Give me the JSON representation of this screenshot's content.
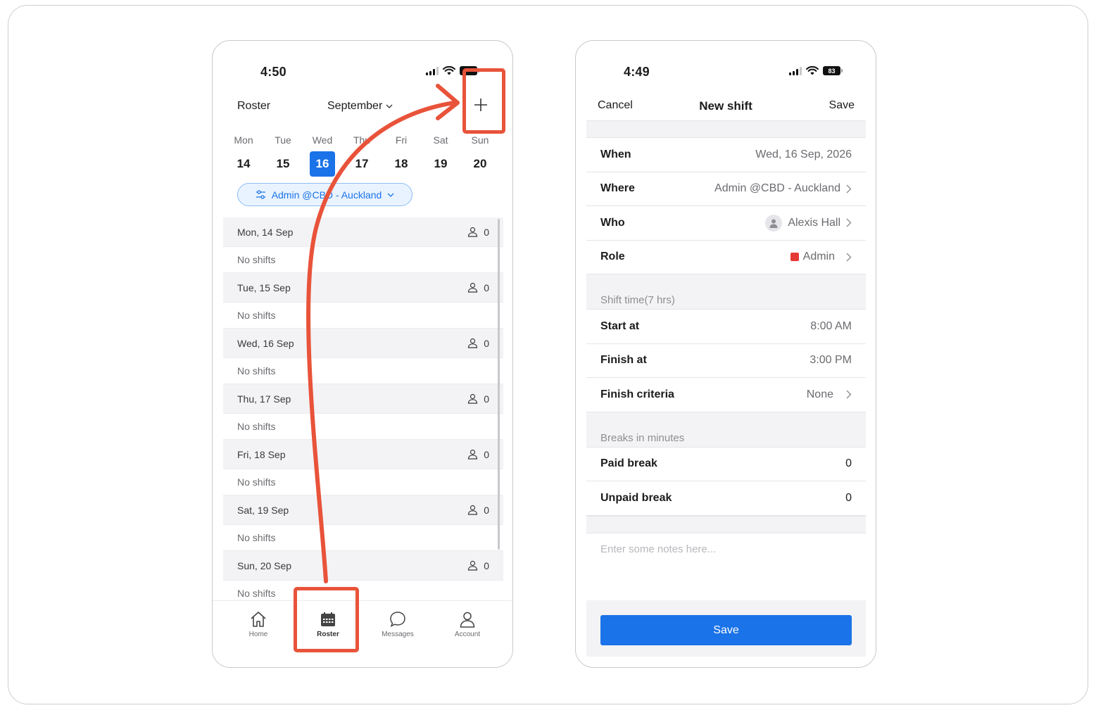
{
  "left_phone": {
    "status": {
      "time": "4:50"
    },
    "header": {
      "title": "Roster",
      "month": "September"
    },
    "week": [
      {
        "name": "Mon",
        "num": "14"
      },
      {
        "name": "Tue",
        "num": "15"
      },
      {
        "name": "Wed",
        "num": "16"
      },
      {
        "name": "Thu",
        "num": "17"
      },
      {
        "name": "Fri",
        "num": "18"
      },
      {
        "name": "Sat",
        "num": "19"
      },
      {
        "name": "Sun",
        "num": "20"
      }
    ],
    "selected_day": "16",
    "location_chip": "Admin @CBD - Auckland",
    "days": [
      {
        "label": "Mon, 14 Sep",
        "count": "0",
        "empty": "No shifts"
      },
      {
        "label": "Tue, 15 Sep",
        "count": "0",
        "empty": "No shifts"
      },
      {
        "label": "Wed, 16 Sep",
        "count": "0",
        "empty": "No shifts"
      },
      {
        "label": "Thu, 17 Sep",
        "count": "0",
        "empty": "No shifts"
      },
      {
        "label": "Fri, 18 Sep",
        "count": "0",
        "empty": "No shifts"
      },
      {
        "label": "Sat, 19 Sep",
        "count": "0",
        "empty": "No shifts"
      },
      {
        "label": "Sun, 20 Sep",
        "count": "0",
        "empty": "No shifts"
      }
    ],
    "tabs": [
      {
        "label": "Home",
        "icon": "home-icon"
      },
      {
        "label": "Roster",
        "icon": "calendar-icon"
      },
      {
        "label": "Messages",
        "icon": "chat-bubble-icon"
      },
      {
        "label": "Account",
        "icon": "person-icon"
      }
    ],
    "active_tab": "Roster"
  },
  "right_phone": {
    "status": {
      "time": "4:49",
      "battery": "83"
    },
    "nav": {
      "cancel": "Cancel",
      "title": "New shift",
      "save": "Save"
    },
    "details": {
      "when": {
        "label": "When",
        "value": "Wed, 16 Sep, 2026"
      },
      "where": {
        "label": "Where",
        "value": "Admin @CBD - Auckland"
      },
      "who": {
        "label": "Who",
        "value": "Alexis Hall"
      },
      "role": {
        "label": "Role",
        "value": "Admin",
        "color": "#e53935"
      }
    },
    "shift_time": {
      "header": "Shift time(7 hrs)",
      "start": {
        "label": "Start at",
        "value": "8:00 AM"
      },
      "finish": {
        "label": "Finish at",
        "value": "3:00 PM"
      },
      "criteria": {
        "label": "Finish criteria",
        "value": "None"
      }
    },
    "breaks": {
      "header": "Breaks in minutes",
      "paid": {
        "label": "Paid break",
        "value": "0"
      },
      "unpaid": {
        "label": "Unpaid break",
        "value": "0"
      }
    },
    "notes_placeholder": "Enter some notes here...",
    "save_button": "Save"
  },
  "colors": {
    "accent": "#1a73e8",
    "annotation": "#e8533a",
    "role": "#e53935"
  }
}
